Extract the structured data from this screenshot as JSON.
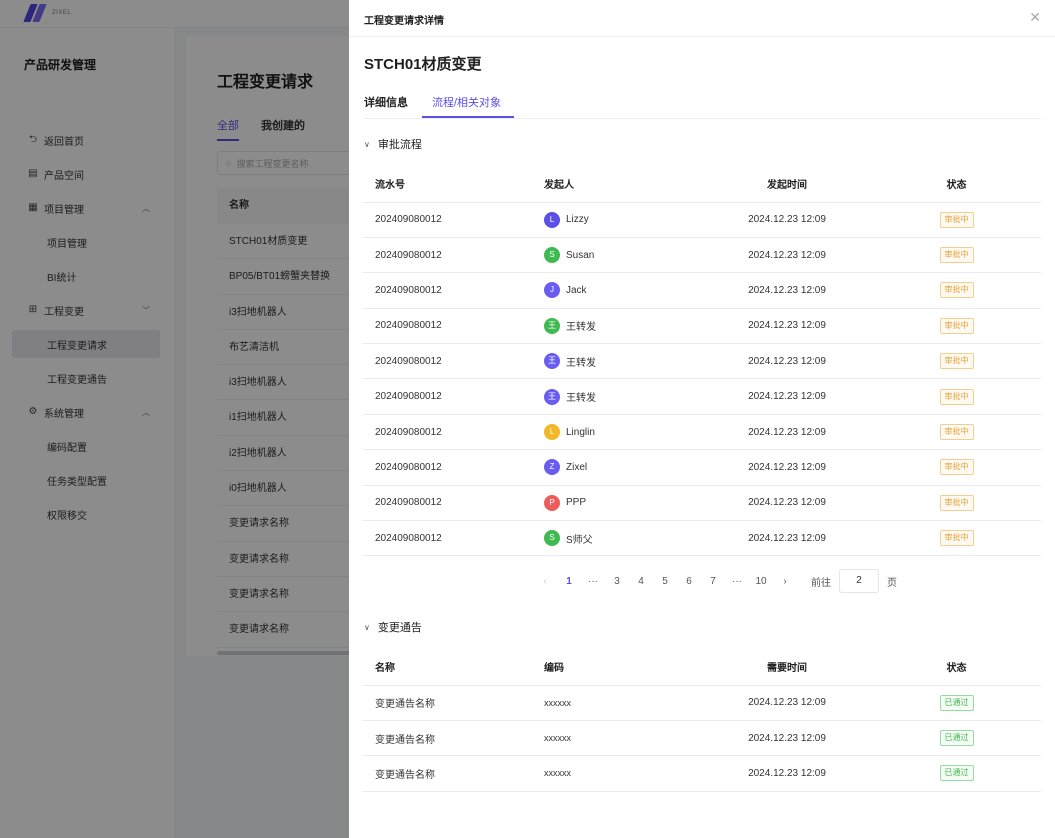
{
  "app": {
    "logo_text": "ZIXEL",
    "sidebar": {
      "title": "产品研发管理",
      "items": [
        {
          "label": "返回首页",
          "icon": "return-icon"
        },
        {
          "label": "产品空间",
          "icon": "product-space-icon"
        },
        {
          "label": "项目管理",
          "icon": "grid-icon",
          "expanded": true
        },
        {
          "label": "项目管理",
          "sub": true
        },
        {
          "label": "BI统计",
          "sub": true
        },
        {
          "label": "工程变更",
          "icon": "change-icon",
          "expanded": false
        },
        {
          "label": "工程变更请求",
          "sub": true,
          "active": true
        },
        {
          "label": "工程变更通告",
          "sub": true
        },
        {
          "label": "系统管理",
          "icon": "settings-icon",
          "expanded": true
        },
        {
          "label": "编码配置",
          "sub": true
        },
        {
          "label": "任务类型配置",
          "sub": true
        },
        {
          "label": "权限移交",
          "sub": true
        }
      ]
    },
    "main": {
      "title": "工程变更请求",
      "tabs": [
        "全部",
        "我创建的"
      ],
      "search_placeholder": "搜索工程变更名称",
      "table_header": "名称",
      "rows": [
        "STCH01材质变更",
        "BP05/BT01螃蟹夹替换",
        "i3扫地机器人",
        "布艺清洁机",
        "i3扫地机器人",
        "i1扫地机器人",
        "i2扫地机器人",
        "i0扫地机器人",
        "变更请求名称",
        "变更请求名称",
        "变更请求名称",
        "变更请求名称"
      ]
    }
  },
  "drawer": {
    "title": "工程变更请求详情",
    "close_icon": "close-icon",
    "record_title": "STCH01材质变更",
    "tabs": [
      "详细信息",
      "流程/相关对象"
    ],
    "active_tab": 1,
    "approval": {
      "title": "审批流程",
      "columns": [
        "流水号",
        "发起人",
        "发起时间",
        "状态"
      ],
      "rows": [
        {
          "serial": "202409080012",
          "initial": "L",
          "name": "Lizzy",
          "color": "#5b4fe6",
          "time": "2024.12.23 12:09",
          "status": "审批中"
        },
        {
          "serial": "202409080012",
          "initial": "S",
          "name": "Susan",
          "color": "#3fb950",
          "time": "2024.12.23 12:09",
          "status": "审批中"
        },
        {
          "serial": "202409080012",
          "initial": "J",
          "name": "Jack",
          "color": "#6a5cf0",
          "time": "2024.12.23 12:09",
          "status": "审批中"
        },
        {
          "serial": "202409080012",
          "initial": "王",
          "name": "王转发",
          "color": "#3fb950",
          "time": "2024.12.23 12:09",
          "status": "审批中"
        },
        {
          "serial": "202409080012",
          "initial": "王",
          "name": "王转发",
          "color": "#6a5cf0",
          "time": "2024.12.23 12:09",
          "status": "审批中"
        },
        {
          "serial": "202409080012",
          "initial": "王",
          "name": "王转发",
          "color": "#6a5cf0",
          "time": "2024.12.23 12:09",
          "status": "审批中"
        },
        {
          "serial": "202409080012",
          "initial": "L",
          "name": "Linglin",
          "color": "#f2b825",
          "time": "2024.12.23 12:09",
          "status": "审批中"
        },
        {
          "serial": "202409080012",
          "initial": "Z",
          "name": "Zixel",
          "color": "#6a5cf0",
          "time": "2024.12.23 12:09",
          "status": "审批中"
        },
        {
          "serial": "202409080012",
          "initial": "P",
          "name": "PPP",
          "color": "#ef5b5b",
          "time": "2024.12.23 12:09",
          "status": "审批中"
        },
        {
          "serial": "202409080012",
          "initial": "S",
          "name": "S师父",
          "color": "#3fb950",
          "time": "2024.12.23 12:09",
          "status": "审批中"
        }
      ]
    },
    "pagination": {
      "prev": "‹",
      "next": "›",
      "pages": [
        "1",
        "···",
        "3",
        "4",
        "5",
        "6",
        "7",
        "···",
        "10"
      ],
      "current": "1",
      "goto_label": "前往",
      "goto_value": "2",
      "page_suffix": "页"
    },
    "notices": {
      "title": "变更通告",
      "columns": [
        "名称",
        "编码",
        "需要时间",
        "状态"
      ],
      "rows": [
        {
          "name": "变更通告名称",
          "code": "xxxxxx",
          "time": "2024.12.23 12:09",
          "status": "已通过"
        },
        {
          "name": "变更通告名称",
          "code": "xxxxxx",
          "time": "2024.12.23 12:09",
          "status": "已通过"
        },
        {
          "name": "变更通告名称",
          "code": "xxxxxx",
          "time": "2024.12.23 12:09",
          "status": "已通过"
        }
      ]
    }
  }
}
